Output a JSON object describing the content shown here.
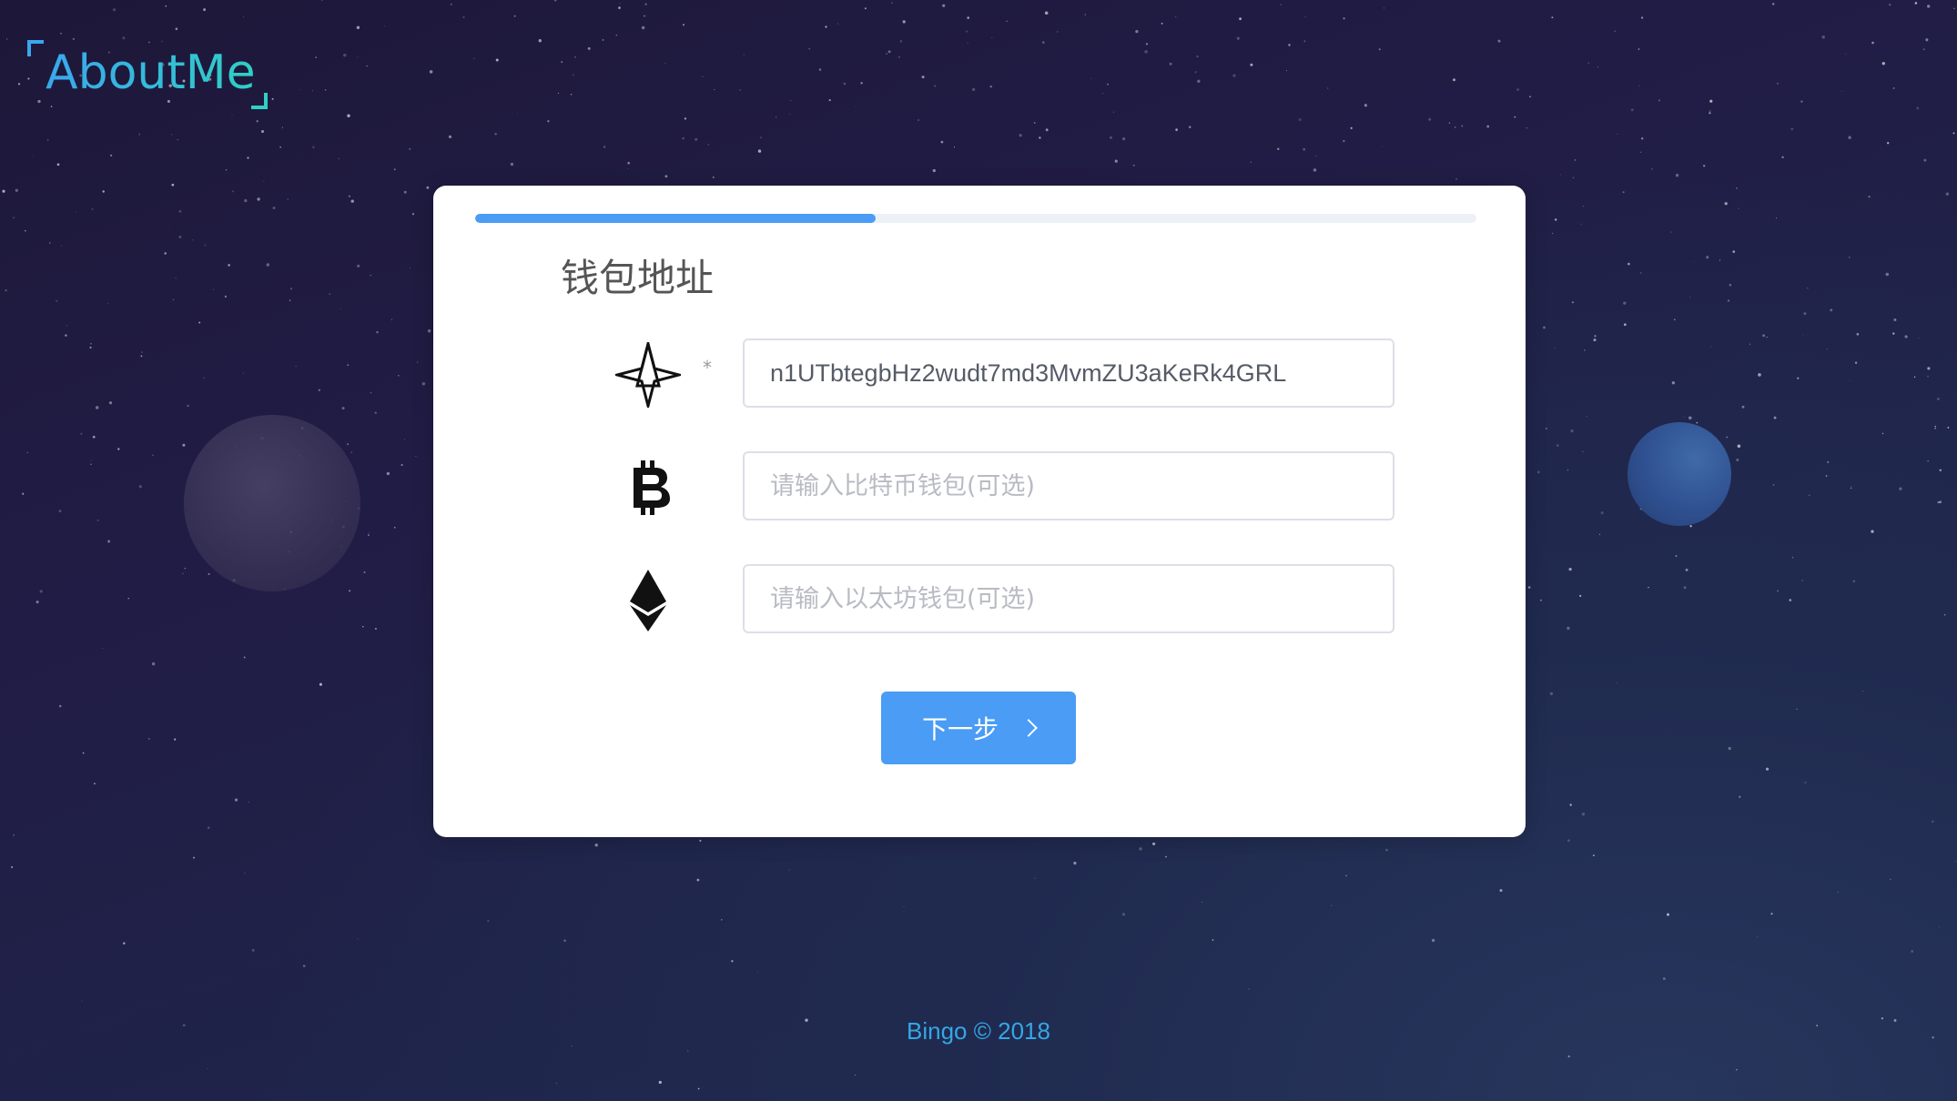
{
  "brand": {
    "logo_text": "AboutMe",
    "accent_start": "#3aa6ee",
    "accent_end": "#2fd0c6"
  },
  "progress": {
    "fraction": 0.4
  },
  "form": {
    "title": "钱包地址",
    "fields": [
      {
        "icon": "nebulas-icon",
        "required_mark": "*",
        "value": "n1UTbtegbHz2wudt7md3MvmZU3aKeRk4GRL",
        "placeholder": ""
      },
      {
        "icon": "bitcoin-icon",
        "value": "",
        "placeholder": "请输入比特币钱包(可选)"
      },
      {
        "icon": "ethereum-icon",
        "value": "",
        "placeholder": "请输入以太坊钱包(可选)"
      }
    ],
    "next_label": "下一步"
  },
  "footer": {
    "text": "Bingo © 2018"
  },
  "colors": {
    "primary": "#4a9cf5",
    "footer_text": "#34a7e6"
  }
}
